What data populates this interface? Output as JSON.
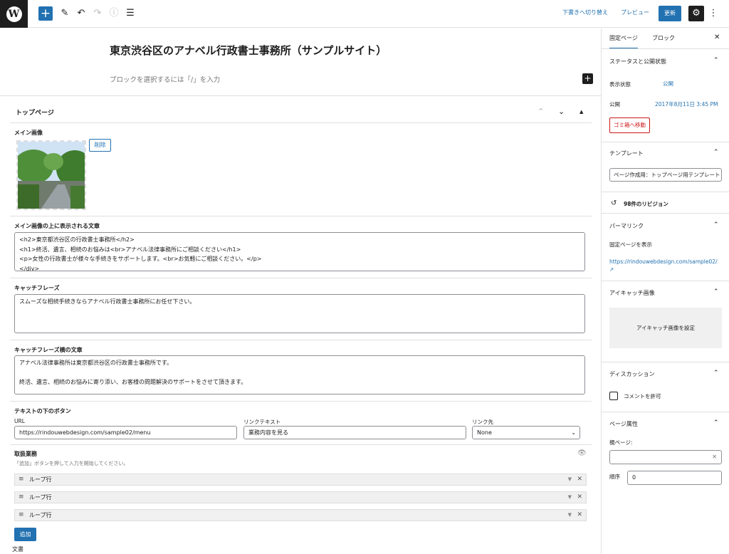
{
  "toolbar": {
    "save_draft": "下書きへ切り替え",
    "preview": "プレビュー",
    "update": "更新"
  },
  "editor": {
    "title": "東京渋谷区のアナベル行政書士事務所（サンプルサイト）",
    "block_hint": "ブロックを選択するには「/」を入力"
  },
  "metabox": {
    "title": "トップページ",
    "main_image_label": "メイン画像",
    "delete_label": "削除",
    "overlay_label": "メイン画像の上に表示される文章",
    "overlay_lines": [
      "<h2>東京都渋谷区の行政書士事務所</h2>",
      "<h1>終活、遺言、相続のお悩みは<br>アナベル法律事務所にご相談ください</h1>",
      "<p>女性の行政書士が様々な手続きをサポートします。<br>お気軽にご相談ください。</p>",
      "</div>"
    ],
    "catch_label": "キャッチフレーズ",
    "catch_value": "スムーズな相続手続きならアナベル行政書士事務所にお任せ下さい。",
    "side_label": "キャッチフレーズ横の文章",
    "side_lines": [
      "アナベル法律事務所は東京都渋谷区の行政書士事務所です。",
      "",
      "終活、遺言、相続のお悩みに寄り添い、お客様の問題解決のサポートをさせて頂きます。"
    ],
    "button_label": "テキストの下のボタン",
    "url_label": "URL",
    "url_value": "https://rindouwebdesign.com/sample02/menu",
    "link_text_label": "リンクテキスト",
    "link_text_value": "業務内容を見る",
    "link_target_label": "リンク先",
    "link_target_value": "None",
    "services_label": "取扱業務",
    "services_hint": "「追加」ボタンを押して入力を開始してください。",
    "loop_rows": [
      "ループ行",
      "ループ行",
      "ループ行"
    ],
    "add_label": "追加"
  },
  "footer": {
    "label": "文書"
  },
  "sidebar": {
    "tab_page": "固定ページ",
    "tab_block": "ブロック",
    "status_title": "ステータスと公開状態",
    "visibility_label": "表示状態",
    "visibility_value": "公開",
    "publish_label": "公開",
    "publish_value": "2017年8月11日 3:45 PM",
    "trash_label": "ゴミ箱へ移動",
    "template_title": "テンプレート",
    "template_value": "ページ作成用：トップページ用テンプレート",
    "revisions": "98件のリビジョン",
    "permalink_title": "パーマリンク",
    "permalink_view": "固定ページを表示",
    "permalink_url": "https://rindouwebdesign.com/sample02/",
    "eyecatch_title": "アイキャッチ画像",
    "eyecatch_button": "アイキャッチ画像を設定",
    "discussion_title": "ディスカッション",
    "comments_label": "コメントを許可",
    "attributes_title": "ページ属性",
    "parent_label": "親ページ:",
    "order_label": "順序",
    "order_value": "0"
  }
}
